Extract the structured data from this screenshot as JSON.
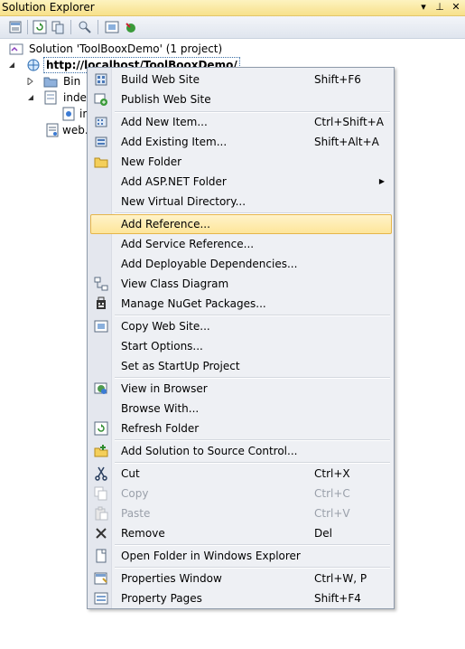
{
  "panel": {
    "title": "Solution Explorer",
    "pin_glyph": "▾",
    "dock_glyph": "⊥",
    "close_glyph": "✕"
  },
  "tree": {
    "solution": "Solution 'ToolBooxDemo' (1 project)",
    "project": "http://localhost/ToolBooxDemo/",
    "bin": "Bin",
    "index": "index",
    "index_child": "in",
    "web": "web."
  },
  "menu": {
    "items": [
      {
        "label": "Build Web Site",
        "shortcut": "Shift+F6",
        "icon": "build-icon"
      },
      {
        "label": "Publish Web Site",
        "shortcut": "",
        "icon": "publish-icon"
      },
      {
        "label": "Add New Item...",
        "shortcut": "Ctrl+Shift+A",
        "icon": "new-item-icon"
      },
      {
        "label": "Add Existing Item...",
        "shortcut": "Shift+Alt+A",
        "icon": "existing-item-icon"
      },
      {
        "label": "New Folder",
        "shortcut": "",
        "icon": "folder-icon"
      },
      {
        "label": "Add ASP.NET Folder",
        "shortcut": "",
        "icon": "",
        "submenu": true
      },
      {
        "label": "New Virtual Directory...",
        "shortcut": "",
        "icon": ""
      },
      {
        "label": "Add Reference...",
        "shortcut": "",
        "icon": "",
        "highlight": true
      },
      {
        "label": "Add Service Reference...",
        "shortcut": "",
        "icon": ""
      },
      {
        "label": "Add Deployable Dependencies...",
        "shortcut": "",
        "icon": ""
      },
      {
        "label": "View Class Diagram",
        "shortcut": "",
        "icon": "class-diagram-icon"
      },
      {
        "label": "Manage NuGet Packages...",
        "shortcut": "",
        "icon": "nuget-icon"
      },
      {
        "label": "Copy Web Site...",
        "shortcut": "",
        "icon": "copy-website-icon"
      },
      {
        "label": "Start Options...",
        "shortcut": "",
        "icon": ""
      },
      {
        "label": "Set as StartUp Project",
        "shortcut": "",
        "icon": ""
      },
      {
        "label": "View in Browser",
        "shortcut": "",
        "icon": "browser-icon"
      },
      {
        "label": "Browse With...",
        "shortcut": "",
        "icon": ""
      },
      {
        "label": "Refresh Folder",
        "shortcut": "",
        "icon": "refresh-icon"
      },
      {
        "label": "Add Solution to Source Control...",
        "shortcut": "",
        "icon": "source-control-icon"
      },
      {
        "label": "Cut",
        "shortcut": "Ctrl+X",
        "icon": "scissors-icon"
      },
      {
        "label": "Copy",
        "shortcut": "Ctrl+C",
        "icon": "copy-icon",
        "disabled": true
      },
      {
        "label": "Paste",
        "shortcut": "Ctrl+V",
        "icon": "paste-icon",
        "disabled": true
      },
      {
        "label": "Remove",
        "shortcut": "Del",
        "icon": "remove-icon"
      },
      {
        "label": "Open Folder in Windows Explorer",
        "shortcut": "",
        "icon": "open-folder-icon"
      },
      {
        "label": "Properties Window",
        "shortcut": "Ctrl+W, P",
        "icon": "properties-icon"
      },
      {
        "label": "Property Pages",
        "shortcut": "Shift+F4",
        "icon": "property-pages-icon"
      }
    ]
  }
}
